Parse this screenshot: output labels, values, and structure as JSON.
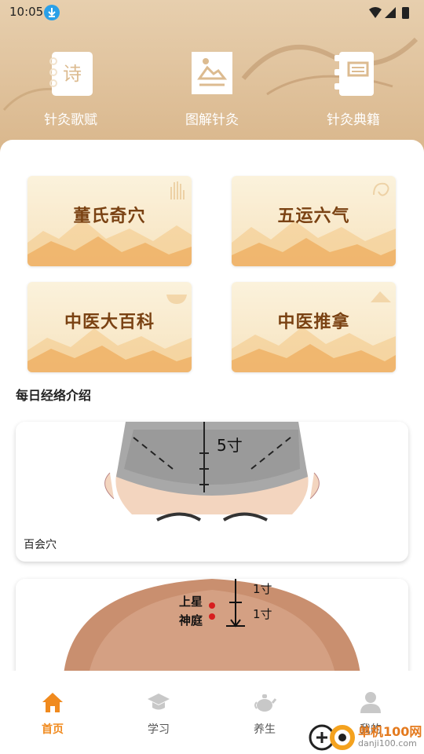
{
  "status_bar": {
    "time": "10:05",
    "icons": [
      "download-icon",
      "wifi-icon",
      "signal-icon",
      "battery-icon"
    ]
  },
  "top_nav": [
    {
      "label": "针灸歌赋",
      "icon": "poem-notebook-icon",
      "icon_char": "诗"
    },
    {
      "label": "图解针灸",
      "icon": "picture-icon"
    },
    {
      "label": "针灸典籍",
      "icon": "book-icon"
    }
  ],
  "tiles": [
    {
      "label": "董氏奇穴"
    },
    {
      "label": "五运六气"
    },
    {
      "label": "中医大百科"
    },
    {
      "label": "中医推拿"
    }
  ],
  "section": {
    "title": "每日经络介绍"
  },
  "cards": [
    {
      "caption": "百会穴",
      "img_label": "5寸"
    },
    {
      "caption": "",
      "labels": [
        "上星",
        "神庭",
        "1寸",
        "1寸"
      ]
    }
  ],
  "tab_bar": [
    {
      "label": "首页",
      "icon": "home-icon",
      "active": true
    },
    {
      "label": "学习",
      "icon": "graduation-cap-icon",
      "active": false
    },
    {
      "label": "养生",
      "icon": "teapot-icon",
      "active": false
    },
    {
      "label": "我的",
      "icon": "user-icon",
      "active": false
    }
  ],
  "watermark": {
    "line1": "单机100网",
    "line2": "danji100.com"
  },
  "colors": {
    "accent": "#f08a1e",
    "header_bg": "#dcbb90",
    "tile_text": "#7a4213"
  }
}
